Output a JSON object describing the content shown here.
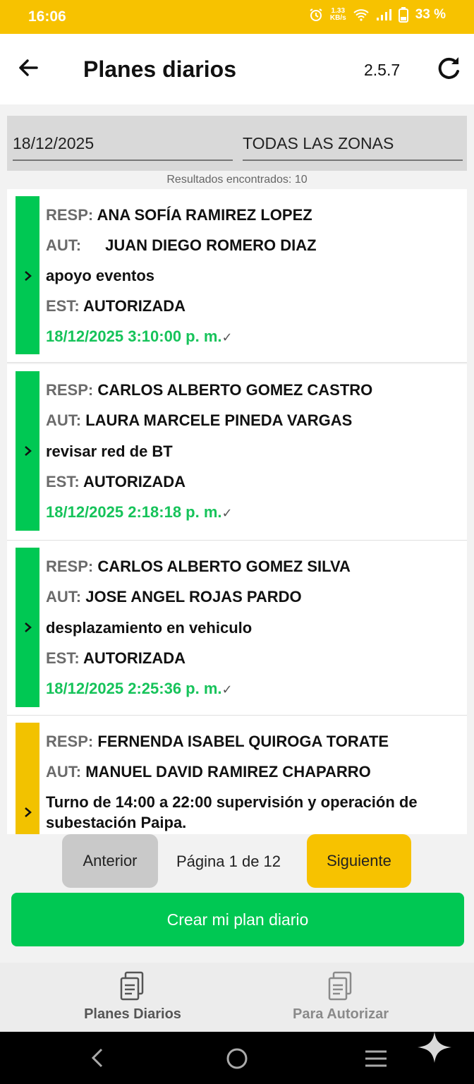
{
  "status_bar": {
    "time": "16:06",
    "net_speed_top": "1.33",
    "net_speed_bottom": "KB/s",
    "battery": "33 %"
  },
  "appbar": {
    "title": "Planes diarios",
    "version": "2.5.7"
  },
  "filters": {
    "date": "18/12/2025",
    "zone": "TODAS LAS ZONAS"
  },
  "results_text": "Resultados encontrados: 10",
  "labels": {
    "resp": "RESP:",
    "aut": "AUT:",
    "est": "EST:"
  },
  "cards": [
    {
      "resp": "ANA SOFÍA RAMIREZ LOPEZ",
      "aut": "JUAN DIEGO ROMERO DIAZ",
      "desc": "apoyo eventos",
      "est": "AUTORIZADA",
      "datetime": "18/12/2025 3:10:00 p. m.",
      "status_color": "#00c853"
    },
    {
      "resp": "CARLOS ALBERTO GOMEZ CASTRO",
      "aut": "LAURA MARCELE PINEDA VARGAS",
      "desc": "revisar red de BT",
      "est": "AUTORIZADA",
      "datetime": "18/12/2025 2:18:18 p. m.",
      "status_color": "#00c853"
    },
    {
      "resp": "CARLOS ALBERTO GOMEZ SILVA",
      "aut": "JOSE ANGEL ROJAS PARDO",
      "desc": "desplazamiento en vehiculo",
      "est": "AUTORIZADA",
      "datetime": "18/12/2025 2:25:36 p. m.",
      "status_color": "#00c853"
    },
    {
      "resp": "FERNENDA ISABEL QUIROGA TORATE",
      "aut": "MANUEL DAVID RAMIREZ CHAPARRO",
      "desc": "Turno de 14:00 a 22:00 supervisión y operación de subestación Paipa.",
      "status_color": "#f2c200"
    }
  ],
  "check_mark": "✓",
  "pager": {
    "prev": "Anterior",
    "page": "Página 1 de 12",
    "next": "Siguiente"
  },
  "create_button": "Crear mi plan diario",
  "bottom_nav": {
    "item1": "Planes Diarios",
    "item2": "Para Autorizar"
  },
  "colors": {
    "accent_yellow": "#f7c200",
    "accent_green": "#00c853"
  }
}
